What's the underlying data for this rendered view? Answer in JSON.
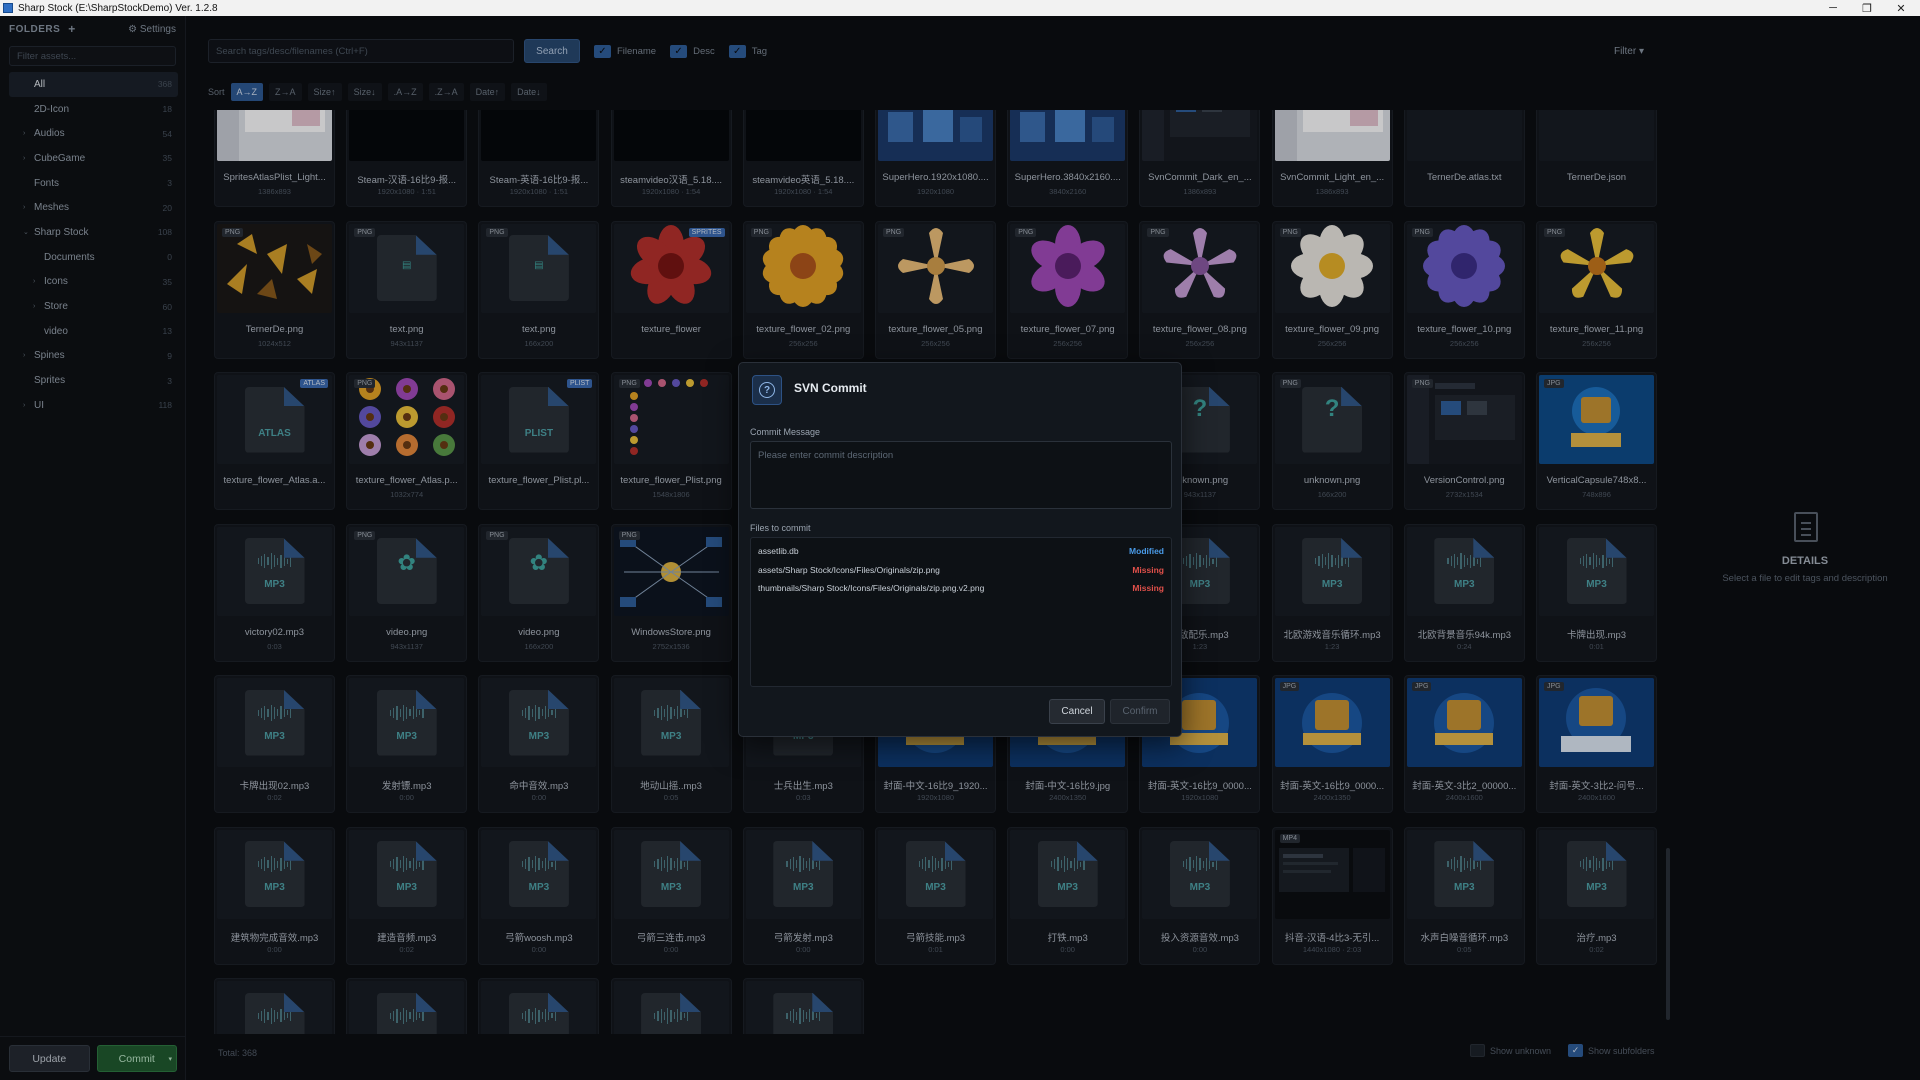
{
  "window": {
    "title": "Sharp Stock (E:\\SharpStockDemo) Ver. 1.2.8",
    "minimize": "─",
    "restore": "❐",
    "close": "✕"
  },
  "sidebar": {
    "header": "FOLDERS",
    "add_icon": "+",
    "settings_label": "⚙ Settings",
    "filter_placeholder": "Filter assets...",
    "items": [
      {
        "label": "All",
        "count": "368",
        "arrow": ""
      },
      {
        "label": "2D-Icon",
        "count": "18",
        "arrow": ""
      },
      {
        "label": "Audios",
        "count": "54",
        "arrow": "›"
      },
      {
        "label": "CubeGame",
        "count": "35",
        "arrow": "›"
      },
      {
        "label": "Fonts",
        "count": "3",
        "arrow": ""
      },
      {
        "label": "Meshes",
        "count": "20",
        "arrow": "›"
      },
      {
        "label": "Sharp Stock",
        "count": "108",
        "arrow": "⌄"
      },
      {
        "label": "Documents",
        "count": "0",
        "arrow": ""
      },
      {
        "label": "Icons",
        "count": "35",
        "arrow": "›"
      },
      {
        "label": "Store",
        "count": "60",
        "arrow": "›"
      },
      {
        "label": "video",
        "count": "13",
        "arrow": ""
      },
      {
        "label": "Spines",
        "count": "9",
        "arrow": "›"
      },
      {
        "label": "Sprites",
        "count": "3",
        "arrow": ""
      },
      {
        "label": "UI",
        "count": "118",
        "arrow": "›"
      }
    ],
    "update_label": "Update",
    "commit_label": "Commit",
    "commit_dropdown": "▾"
  },
  "toolbar": {
    "search_placeholder": "Search tags/desc/filenames (Ctrl+F)",
    "search_button": "Search",
    "checks": [
      "Filename",
      "Desc",
      "Tag"
    ],
    "check_mark": "✓",
    "filter_label": "Filter ▾"
  },
  "sort": {
    "label": "Sort",
    "options": [
      "A→Z",
      "Z→A",
      "Size↑",
      "Size↓",
      ".A→Z",
      ".Z→A",
      "Date↑",
      "Date↓"
    ],
    "active_index": 0
  },
  "assets": [
    {
      "name": "SpritesAtlasPlist_Light...",
      "meta": "1386x893",
      "thumb": "screenshot-light",
      "badge": ""
    },
    {
      "name": "Steam-汉语-16比9-报...",
      "meta": "1920x1080 · 1:51",
      "thumb": "video",
      "badge": ""
    },
    {
      "name": "Steam-英语-16比9-报...",
      "meta": "1920x1080 · 1:51",
      "thumb": "video",
      "badge": ""
    },
    {
      "name": "steamvideo汉语_5.18....",
      "meta": "1920x1080 · 1:54",
      "thumb": "video",
      "badge": ""
    },
    {
      "name": "steamvideo英语_5.18....",
      "meta": "1920x1080 · 1:54",
      "thumb": "video",
      "badge": ""
    },
    {
      "name": "SuperHero.1920x1080....",
      "meta": "1920x1080",
      "thumb": "game-blue",
      "badge": ""
    },
    {
      "name": "SuperHero.3840x2160....",
      "meta": "3840x2160",
      "thumb": "game-blue",
      "badge": ""
    },
    {
      "name": "SvnCommit_Dark_en_...",
      "meta": "1386x893",
      "thumb": "screenshot-dark",
      "badge": ""
    },
    {
      "name": "SvnCommit_Light_en_...",
      "meta": "1386x893",
      "thumb": "screenshot-light",
      "badge": ""
    },
    {
      "name": "TernerDe.atlas.txt",
      "meta": "",
      "thumb": "atlas-text",
      "badge": ""
    },
    {
      "name": "TernerDe.json",
      "meta": "",
      "thumb": "blank",
      "badge": ""
    },
    {
      "name": "TernerDe.png",
      "meta": "1024x512",
      "thumb": "sprite-sheet",
      "badge": "PNG"
    },
    {
      "name": "text.png",
      "meta": "943x1137",
      "thumb": "doc",
      "badge": "PNG"
    },
    {
      "name": "text.png",
      "meta": "166x200",
      "thumb": "doc",
      "badge": "PNG"
    },
    {
      "name": "texture_flower",
      "meta": "",
      "thumb": "flower-red",
      "badge": "SPRITES"
    },
    {
      "name": "texture_flower_02.png",
      "meta": "256x256",
      "thumb": "flower-orange",
      "badge": "PNG"
    },
    {
      "name": "texture_flower_05.png",
      "meta": "256x256",
      "thumb": "flower-tulip",
      "badge": "PNG"
    },
    {
      "name": "texture_flower_07.png",
      "meta": "256x256",
      "thumb": "flower-purple",
      "badge": "PNG"
    },
    {
      "name": "texture_flower_08.png",
      "meta": "256x256",
      "thumb": "flower-lotus",
      "badge": "PNG"
    },
    {
      "name": "texture_flower_09.png",
      "meta": "256x256",
      "thumb": "flower-white",
      "badge": "PNG"
    },
    {
      "name": "texture_flower_10.png",
      "meta": "256x256",
      "thumb": "flower-violet",
      "badge": "PNG"
    },
    {
      "name": "texture_flower_11.png",
      "meta": "256x256",
      "thumb": "flower-yellow",
      "badge": "PNG"
    },
    {
      "name": "texture_flower_Atlas.a...",
      "meta": "",
      "thumb": "atlas-file",
      "badge": "ATLAS"
    },
    {
      "name": "texture_flower_Atlas.p...",
      "meta": "1032x774",
      "thumb": "flower-grid",
      "badge": "PNG"
    },
    {
      "name": "texture_flower_Plist.pl...",
      "meta": "",
      "thumb": "plist-file",
      "badge": "PLIST"
    },
    {
      "name": "texture_flower_Plist.png",
      "meta": "1548x1806",
      "thumb": "flower-strip",
      "badge": "PNG"
    },
    {
      "name": "",
      "meta": "",
      "thumb": "hidden",
      "badge": ""
    },
    {
      "name": "",
      "meta": "",
      "thumb": "hidden",
      "badge": ""
    },
    {
      "name": "",
      "meta": "",
      "thumb": "hidden",
      "badge": ""
    },
    {
      "name": "unknown.png",
      "meta": "943x1137",
      "thumb": "unknown",
      "badge": "PNG"
    },
    {
      "name": "unknown.png",
      "meta": "166x200",
      "thumb": "unknown",
      "badge": "PNG"
    },
    {
      "name": "VersionControl.png",
      "meta": "2732x1534",
      "thumb": "screenshot-dark",
      "badge": "PNG"
    },
    {
      "name": "VerticalCapsule748x8...",
      "meta": "748x896",
      "thumb": "capsule",
      "badge": "JPG"
    },
    {
      "name": "victory02.mp3",
      "meta": "0:03",
      "thumb": "mp3",
      "badge": ""
    },
    {
      "name": "video.png",
      "meta": "943x1137",
      "thumb": "video-file",
      "badge": "PNG"
    },
    {
      "name": "video.png",
      "meta": "166x200",
      "thumb": "video-file",
      "badge": "PNG"
    },
    {
      "name": "WindowsStore.png",
      "meta": "2752x1536",
      "thumb": "diagram",
      "badge": "PNG"
    },
    {
      "name": "",
      "meta": "",
      "thumb": "hidden",
      "badge": ""
    },
    {
      "name": "",
      "meta": "",
      "thumb": "hidden",
      "badge": ""
    },
    {
      "name": "",
      "meta": "",
      "thumb": "hidden",
      "badge": ""
    },
    {
      "name": "...敌配乐.mp3",
      "meta": "1:23",
      "thumb": "mp3",
      "badge": ""
    },
    {
      "name": "北欧游戏音乐循环.mp3",
      "meta": "1:23",
      "thumb": "mp3",
      "badge": ""
    },
    {
      "name": "北欧背景音乐94k.mp3",
      "meta": "0:24",
      "thumb": "mp3",
      "badge": ""
    },
    {
      "name": "卡牌出现.mp3",
      "meta": "0:01",
      "thumb": "mp3",
      "badge": ""
    },
    {
      "name": "卡牌出现02.mp3",
      "meta": "0:02",
      "thumb": "mp3",
      "badge": ""
    },
    {
      "name": "发射镖.mp3",
      "meta": "0:00",
      "thumb": "mp3",
      "badge": ""
    },
    {
      "name": "命中音效.mp3",
      "meta": "0:00",
      "thumb": "mp3",
      "badge": ""
    },
    {
      "name": "地动山摇..mp3",
      "meta": "0:05",
      "thumb": "mp3",
      "badge": ""
    },
    {
      "name": "士兵出生.mp3",
      "meta": "0:03",
      "thumb": "mp3",
      "badge": ""
    },
    {
      "name": "封面-中文-16比9_1920...",
      "meta": "1920x1080",
      "thumb": "game-cover",
      "badge": ""
    },
    {
      "name": "封面-中文-16比9.jpg",
      "meta": "2400x1350",
      "thumb": "game-cover",
      "badge": ""
    },
    {
      "name": "封面-英文-16比9_0000...",
      "meta": "1920x1080",
      "thumb": "game-cover",
      "badge": ""
    },
    {
      "name": "封面-英文-16比9_0000...",
      "meta": "2400x1350",
      "thumb": "game-cover",
      "badge": "JPG"
    },
    {
      "name": "封面-英文-3比2_00000...",
      "meta": "2400x1600",
      "thumb": "game-cover",
      "badge": "JPG"
    },
    {
      "name": "封面-英文-3比2-问号...",
      "meta": "2400x1600",
      "thumb": "assets-chaos",
      "badge": "JPG"
    },
    {
      "name": "建筑物完成音效.mp3",
      "meta": "0:00",
      "thumb": "mp3",
      "badge": ""
    },
    {
      "name": "建造音频.mp3",
      "meta": "0:02",
      "thumb": "mp3",
      "badge": ""
    },
    {
      "name": "弓箭woosh.mp3",
      "meta": "0:00",
      "thumb": "mp3",
      "badge": ""
    },
    {
      "name": "弓箭三连击.mp3",
      "meta": "0:00",
      "thumb": "mp3",
      "badge": ""
    },
    {
      "name": "弓箭发射.mp3",
      "meta": "0:00",
      "thumb": "mp3",
      "badge": ""
    },
    {
      "name": "弓箭技能.mp3",
      "meta": "0:01",
      "thumb": "mp3",
      "badge": ""
    },
    {
      "name": "打铁.mp3",
      "meta": "0:00",
      "thumb": "mp3",
      "badge": ""
    },
    {
      "name": "投入资源音效.mp3",
      "meta": "0:00",
      "thumb": "mp3",
      "badge": ""
    },
    {
      "name": "抖音-汉语-4比3-无引...",
      "meta": "1440x1080 · 2:03",
      "thumb": "video-dark",
      "badge": "MP4"
    },
    {
      "name": "水声白噪音循环.mp3",
      "meta": "0:05",
      "thumb": "mp3",
      "badge": ""
    },
    {
      "name": "治疗.mp3",
      "meta": "0:02",
      "thumb": "mp3",
      "badge": ""
    },
    {
      "name": "",
      "meta": "",
      "thumb": "mp3",
      "badge": ""
    },
    {
      "name": "",
      "meta": "",
      "thumb": "mp3",
      "badge": ""
    },
    {
      "name": "",
      "meta": "",
      "thumb": "mp3",
      "badge": ""
    },
    {
      "name": "",
      "meta": "",
      "thumb": "mp3",
      "badge": ""
    },
    {
      "name": "",
      "meta": "",
      "thumb": "mp3",
      "badge": ""
    }
  ],
  "thumb_labels": {
    "mp3": "MP3",
    "atlas": "ATLAS",
    "plist": "PLIST",
    "unknown": "?"
  },
  "status": {
    "total": "Total: 368",
    "show_unknown": "Show unknown",
    "show_subfolders": "Show subfolders",
    "check_mark": "✓"
  },
  "details": {
    "title": "DETAILS",
    "subtitle": "Select a file to edit tags and description"
  },
  "modal": {
    "title": "SVN Commit",
    "icon": "?",
    "commit_message_label": "Commit Message",
    "commit_message_placeholder": "Please enter commit description",
    "files_label": "Files to commit",
    "files": [
      {
        "path": "assetlib.db",
        "status": "Modified",
        "color": "#4a9be8"
      },
      {
        "path": "assets/Sharp Stock/Icons/Files/Originals/zip.png",
        "status": "Missing",
        "color": "#e0504a"
      },
      {
        "path": "thumbnails/Sharp Stock/Icons/Files/Originals/zip.png.v2.png",
        "status": "Missing",
        "color": "#e0504a"
      }
    ],
    "cancel_label": "Cancel",
    "confirm_label": "Confirm"
  },
  "colors": {
    "accent": "#2f5f9c",
    "commit_green": "#1f5a2e",
    "modified": "#4a9be8",
    "missing": "#e0504a"
  }
}
